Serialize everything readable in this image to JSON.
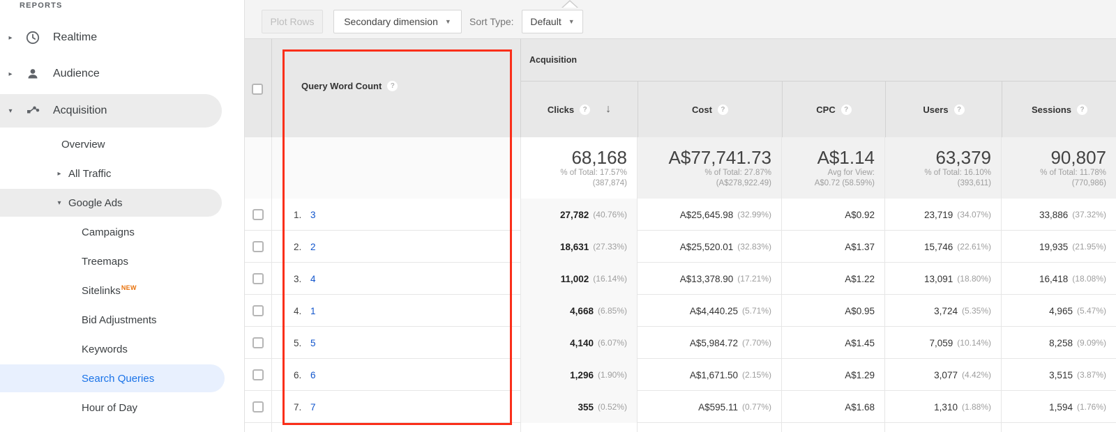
{
  "colors": {
    "accent_blue": "#1a73e8",
    "link_blue": "#1155cc",
    "new_badge_orange": "#e8710a",
    "highlight_red": "#fa2f1a",
    "selected_pill_blue": "#e8f0fe",
    "active_pill_gray": "#ececec",
    "header_gray": "#e8e8e8"
  },
  "sidebar": {
    "section_label": "REPORTS",
    "items": [
      {
        "label": "Realtime"
      },
      {
        "label": "Audience"
      },
      {
        "label": "Acquisition"
      },
      {
        "label": "Overview"
      },
      {
        "label": "All Traffic"
      },
      {
        "label": "Google Ads"
      },
      {
        "label": "Campaigns"
      },
      {
        "label": "Treemaps"
      },
      {
        "label": "Sitelinks",
        "badge": "NEW"
      },
      {
        "label": "Bid Adjustments"
      },
      {
        "label": "Keywords"
      },
      {
        "label": "Search Queries"
      },
      {
        "label": "Hour of Day"
      }
    ]
  },
  "toolbar": {
    "plot_rows_label": "Plot Rows",
    "secondary_dimension_label": "Secondary dimension",
    "sort_type_label": "Sort Type:",
    "sort_type_value": "Default"
  },
  "table": {
    "dimension_header": "Query Word Count",
    "group_header": "Acquisition",
    "columns": [
      "Clicks",
      "Cost",
      "CPC",
      "Users",
      "Sessions"
    ],
    "totals": {
      "clicks": {
        "value": "68,168",
        "sub1": "% of Total: 17.57%",
        "sub2": "(387,874)"
      },
      "cost": {
        "value": "A$77,741.73",
        "sub1": "% of Total: 27.87%",
        "sub2": "(A$278,922.49)"
      },
      "cpc": {
        "value": "A$1.14",
        "sub1": "Avg for View:",
        "sub2": "A$0.72 (58.59%)"
      },
      "users": {
        "value": "63,379",
        "sub1": "% of Total: 16.10%",
        "sub2": "(393,611)"
      },
      "sessions": {
        "value": "90,807",
        "sub1": "% of Total: 11.78%",
        "sub2": "(770,986)"
      }
    },
    "rows": [
      {
        "rank": "1.",
        "word_count": "3",
        "clicks": "27,782",
        "clicks_pct": "(40.76%)",
        "cost": "A$25,645.98",
        "cost_pct": "(32.99%)",
        "cpc": "A$0.92",
        "users": "23,719",
        "users_pct": "(34.07%)",
        "sessions": "33,886",
        "sessions_pct": "(37.32%)"
      },
      {
        "rank": "2.",
        "word_count": "2",
        "clicks": "18,631",
        "clicks_pct": "(27.33%)",
        "cost": "A$25,520.01",
        "cost_pct": "(32.83%)",
        "cpc": "A$1.37",
        "users": "15,746",
        "users_pct": "(22.61%)",
        "sessions": "19,935",
        "sessions_pct": "(21.95%)"
      },
      {
        "rank": "3.",
        "word_count": "4",
        "clicks": "11,002",
        "clicks_pct": "(16.14%)",
        "cost": "A$13,378.90",
        "cost_pct": "(17.21%)",
        "cpc": "A$1.22",
        "users": "13,091",
        "users_pct": "(18.80%)",
        "sessions": "16,418",
        "sessions_pct": "(18.08%)"
      },
      {
        "rank": "4.",
        "word_count": "1",
        "clicks": "4,668",
        "clicks_pct": "(6.85%)",
        "cost": "A$4,440.25",
        "cost_pct": "(5.71%)",
        "cpc": "A$0.95",
        "users": "3,724",
        "users_pct": "(5.35%)",
        "sessions": "4,965",
        "sessions_pct": "(5.47%)"
      },
      {
        "rank": "5.",
        "word_count": "5",
        "clicks": "4,140",
        "clicks_pct": "(6.07%)",
        "cost": "A$5,984.72",
        "cost_pct": "(7.70%)",
        "cpc": "A$1.45",
        "users": "7,059",
        "users_pct": "(10.14%)",
        "sessions": "8,258",
        "sessions_pct": "(9.09%)"
      },
      {
        "rank": "6.",
        "word_count": "6",
        "clicks": "1,296",
        "clicks_pct": "(1.90%)",
        "cost": "A$1,671.50",
        "cost_pct": "(2.15%)",
        "cpc": "A$1.29",
        "users": "3,077",
        "users_pct": "(4.42%)",
        "sessions": "3,515",
        "sessions_pct": "(3.87%)"
      },
      {
        "rank": "7.",
        "word_count": "7",
        "clicks": "355",
        "clicks_pct": "(0.52%)",
        "cost": "A$595.11",
        "cost_pct": "(0.77%)",
        "cpc": "A$1.68",
        "users": "1,310",
        "users_pct": "(1.88%)",
        "sessions": "1,594",
        "sessions_pct": "(1.76%)"
      }
    ]
  }
}
